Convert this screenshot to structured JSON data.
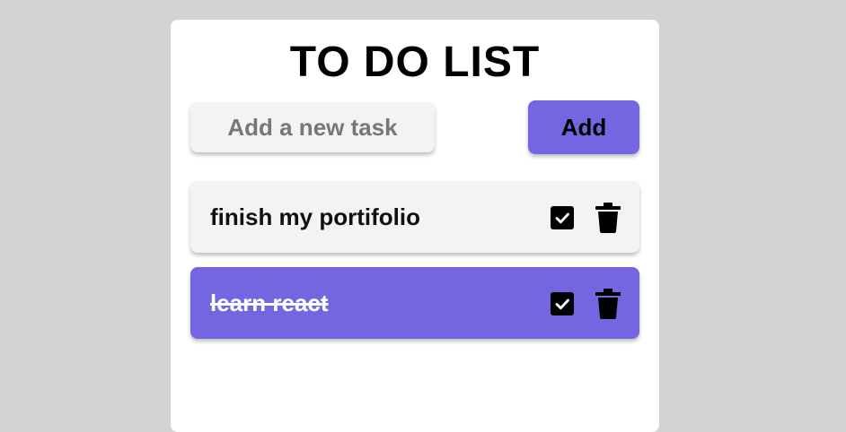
{
  "app": {
    "title": "TO DO LIST"
  },
  "input": {
    "placeholder": "Add a new task",
    "value": ""
  },
  "add_button": {
    "label": "Add"
  },
  "todos": [
    {
      "text": "finish my portifolio",
      "completed": false
    },
    {
      "text": "learn react",
      "completed": true
    }
  ],
  "colors": {
    "background": "#d3d3d3",
    "card": "#ffffff",
    "accent": "#7466e0",
    "item_bg": "#f3f3f3"
  },
  "icons": {
    "check": "checkbox-checked-icon",
    "delete": "trash-icon"
  }
}
